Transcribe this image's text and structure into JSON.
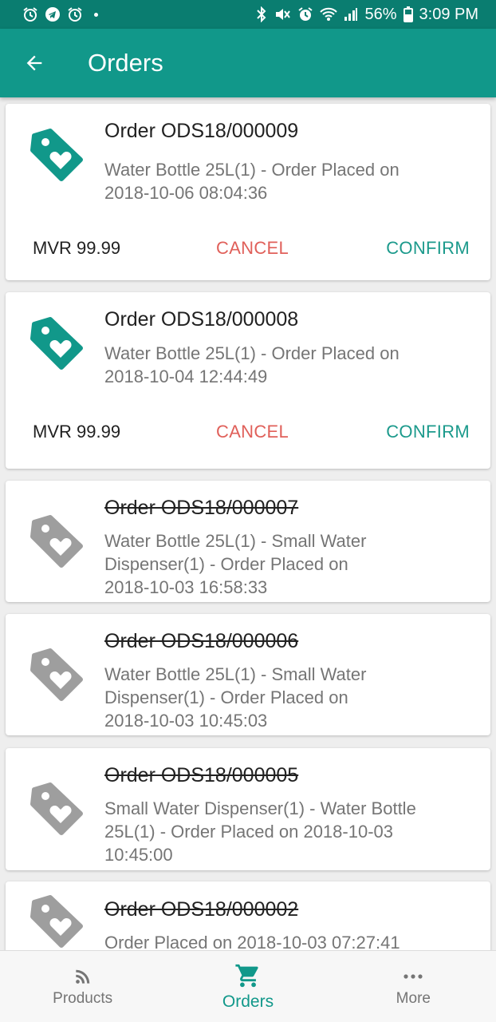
{
  "status_bar": {
    "battery": "56%",
    "time": "3:09 PM",
    "left_icons": [
      "alarm-icon",
      "telegram-icon",
      "clock-icon"
    ],
    "right_icons": [
      "bluetooth-icon",
      "mute-icon",
      "alarm-icon",
      "wifi-icon",
      "signal-icon",
      "battery-icon"
    ]
  },
  "app_bar": {
    "title": "Orders",
    "back_icon": "back-arrow-icon"
  },
  "colors": {
    "primary": "#11988a",
    "primary_dark": "#0a7d70",
    "cancel": "#e0605a",
    "confirm": "#1c9a8c",
    "inactive_icon": "#9e9e9e"
  },
  "orders": [
    {
      "title": "Order ODS18/000009",
      "desc_1": " Water Bottle 25L(1) - Order Placed on",
      "desc_2": "2018-10-06 08:04:36",
      "price": "MVR 99.99",
      "cancel": "CANCEL",
      "confirm": "CONFIRM",
      "status": "active"
    },
    {
      "title": "Order ODS18/000008",
      "desc_1": " Water Bottle 25L(1) - Order Placed on",
      "desc_2": "2018-10-04 12:44:49",
      "price": "MVR 99.99",
      "cancel": "CANCEL",
      "confirm": "CONFIRM",
      "status": "active"
    },
    {
      "title": "Order ODS18/000007",
      "desc_1": " Water Bottle 25L(1) - Small Water",
      "desc_2": "Dispenser(1) - Order Placed on",
      "desc_3": "2018-10-03 16:58:33",
      "status": "cancelled"
    },
    {
      "title": "Order ODS18/000006",
      "desc_1": " Water Bottle 25L(1) - Small Water",
      "desc_2": "Dispenser(1) - Order Placed on",
      "desc_3": "2018-10-03 10:45:03",
      "status": "cancelled"
    },
    {
      "title": "Order ODS18/000005",
      "desc_1": " Small Water Dispenser(1) - Water Bottle",
      "desc_2": "25L(1) - Order Placed on 2018-10-03",
      "desc_3": "10:45:00",
      "status": "cancelled"
    },
    {
      "title": "Order ODS18/000002",
      "desc_1": " Order Placed on 2018-10-03 07:27:41",
      "status": "cancelled"
    }
  ],
  "bottom_nav": [
    {
      "label": "Products",
      "icon": "rss-feed-icon",
      "active": false
    },
    {
      "label": "Orders",
      "icon": "cart-icon",
      "active": true
    },
    {
      "label": "More",
      "icon": "more-dots-icon",
      "active": false
    }
  ]
}
